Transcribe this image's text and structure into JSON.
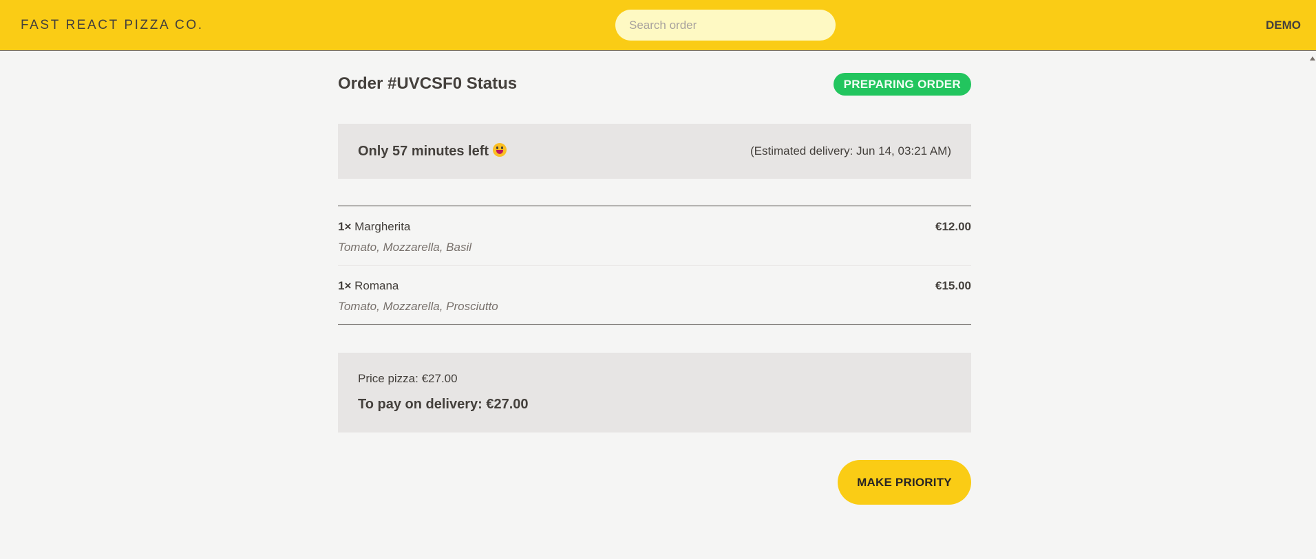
{
  "header": {
    "logo": "FAST REACT PIZZA CO.",
    "search_placeholder": "Search order",
    "username": "DEMO",
    "background_color": "#facc15"
  },
  "order": {
    "title": "Order #UVCSF0 Status",
    "status_badge": "PREPARING ORDER",
    "status_color": "#22c55e",
    "time_left": "Only 57 minutes left",
    "time_left_emoji_icon": "grinning-face-emoji",
    "estimated_delivery": "(Estimated delivery: Jun 14, 03:21 AM)",
    "items": [
      {
        "qty": "1×",
        "name": "Margherita",
        "price": "€12.00",
        "ingredients": "Tomato, Mozzarella, Basil"
      },
      {
        "qty": "1×",
        "name": "Romana",
        "price": "€15.00",
        "ingredients": "Tomato, Mozzarella, Prosciutto"
      }
    ],
    "price_pizza": "Price pizza: €27.00",
    "to_pay": "To pay on delivery: €27.00",
    "priority_button": "MAKE PRIORITY"
  }
}
